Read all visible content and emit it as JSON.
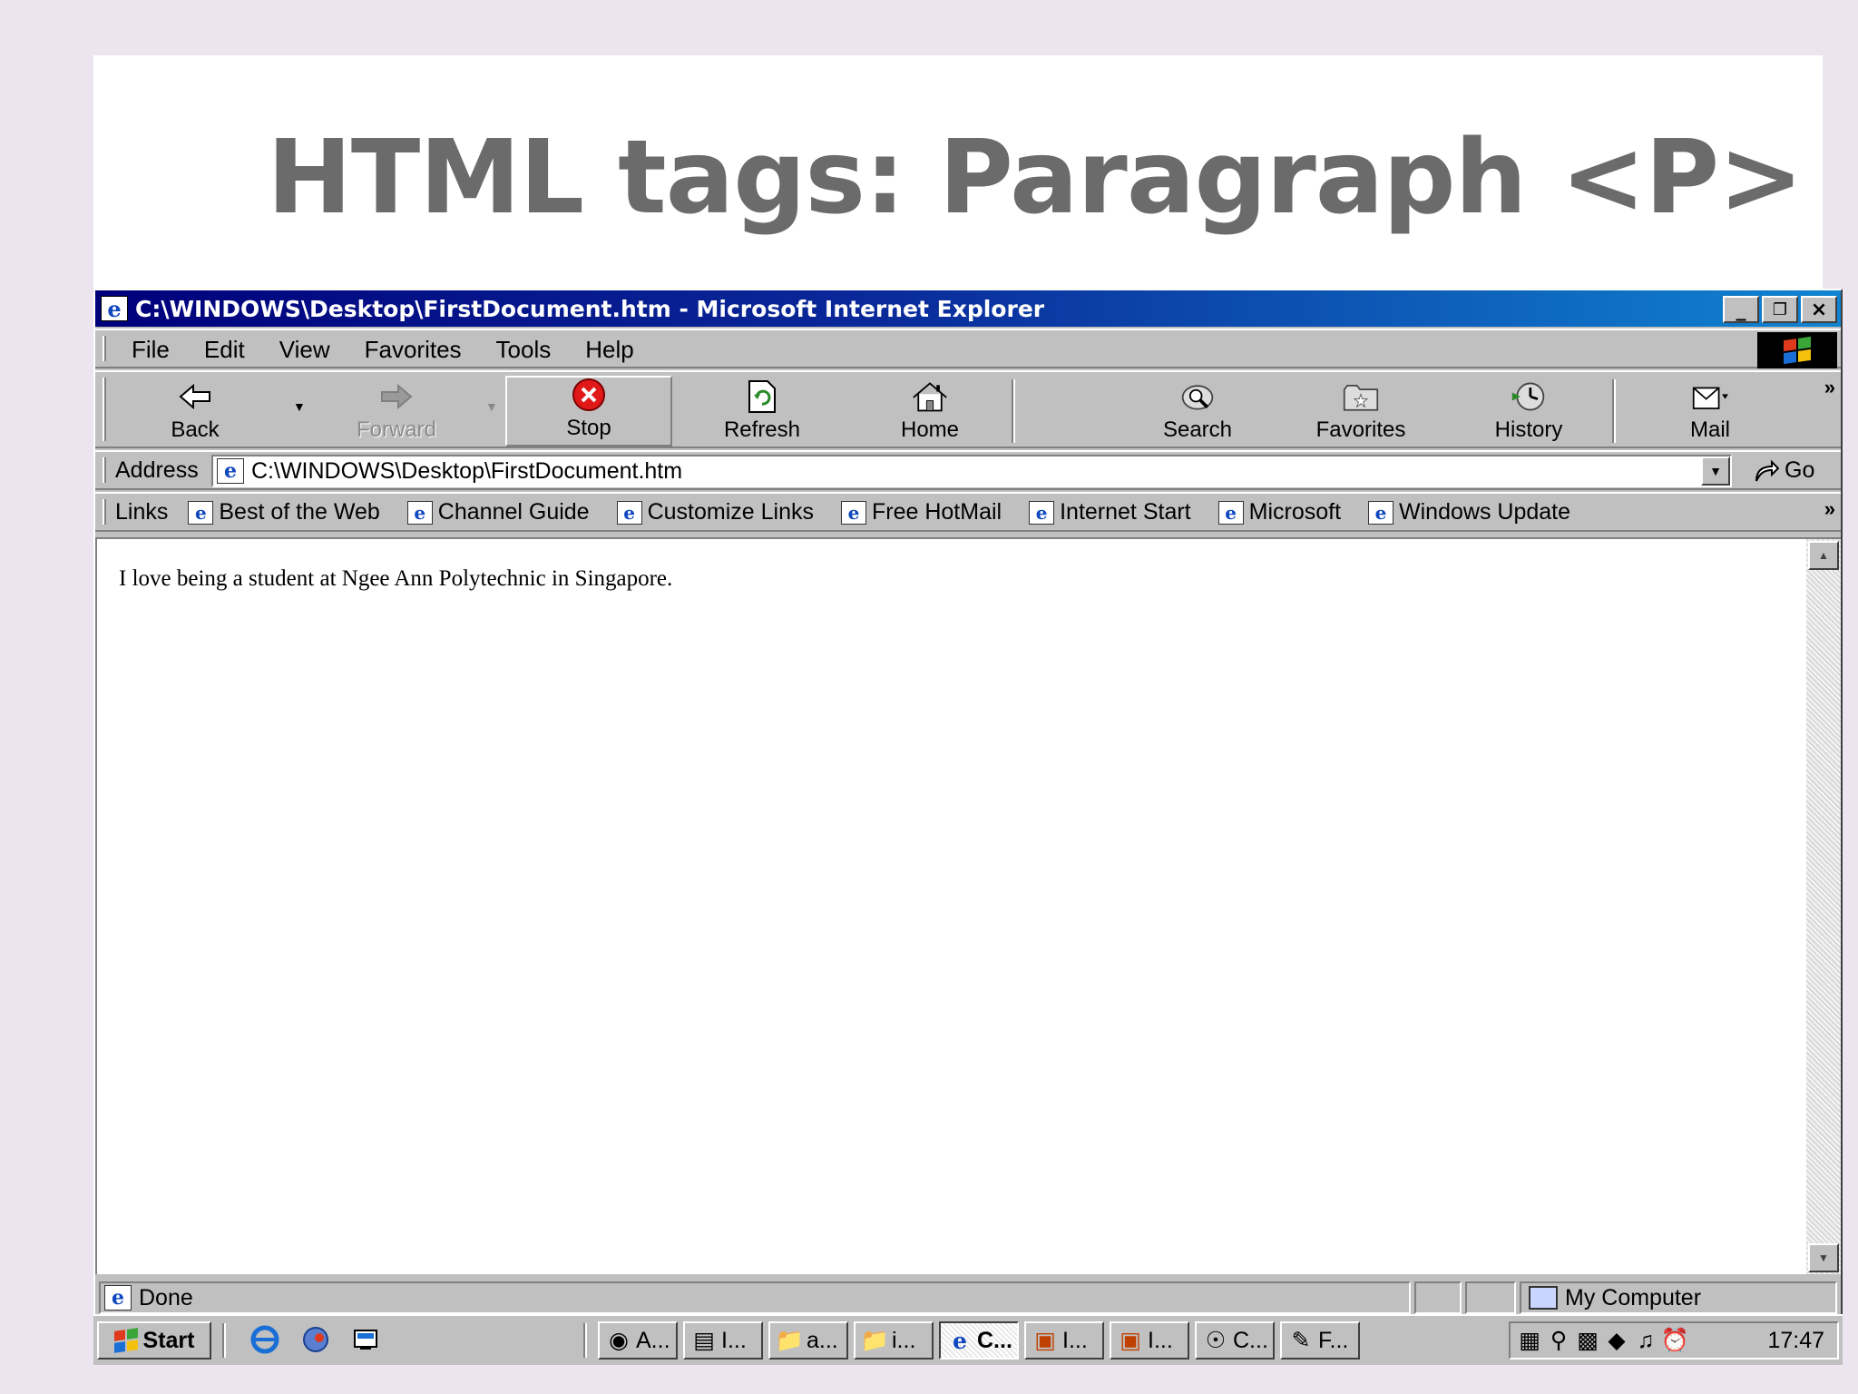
{
  "slide": {
    "title": "HTML tags: Paragraph <P>"
  },
  "window": {
    "title": "C:\\WINDOWS\\Desktop\\FirstDocument.htm - Microsoft Internet Explorer",
    "minimize": "_",
    "restore": "▫",
    "close": "×"
  },
  "menu": {
    "items": [
      "File",
      "Edit",
      "View",
      "Favorites",
      "Tools",
      "Help"
    ]
  },
  "toolbar": {
    "buttons": [
      {
        "label": "Back",
        "icon": "back-arrow-icon",
        "enabled": true
      },
      {
        "label": "Forward",
        "icon": "forward-arrow-icon",
        "enabled": false
      },
      {
        "label": "Stop",
        "icon": "stop-icon",
        "enabled": true
      },
      {
        "label": "Refresh",
        "icon": "refresh-icon",
        "enabled": true
      },
      {
        "label": "Home",
        "icon": "home-icon",
        "enabled": true
      },
      {
        "label": "Search",
        "icon": "search-icon",
        "enabled": true
      },
      {
        "label": "Favorites",
        "icon": "favorites-folder-icon",
        "enabled": true
      },
      {
        "label": "History",
        "icon": "history-icon",
        "enabled": true
      },
      {
        "label": "Mail",
        "icon": "mail-icon",
        "enabled": true
      }
    ],
    "more": "»"
  },
  "address": {
    "label": "Address",
    "value": "C:\\WINDOWS\\Desktop\\FirstDocument.htm",
    "go_label": "Go"
  },
  "links": {
    "label": "Links",
    "items": [
      "Best of the Web",
      "Channel Guide",
      "Customize Links",
      "Free HotMail",
      "Internet Start",
      "Microsoft",
      "Windows Update"
    ],
    "more": "»"
  },
  "page": {
    "paragraph": "I love being a student at Ngee Ann Polytechnic in Singapore."
  },
  "status": {
    "text": "Done",
    "zone": "My Computer"
  },
  "taskbar": {
    "start_label": "Start",
    "tasks": [
      "A...",
      "I...",
      "a...",
      "i...",
      "C...",
      "I...",
      "I...",
      "C...",
      "F..."
    ],
    "active_task_index": 4,
    "clock": "17:47"
  },
  "colors": {
    "title_gradient_start": "#00007a",
    "title_gradient_end": "#1084d0",
    "chrome": "#c0c0c0",
    "slide_title": "#6b6b6b"
  }
}
